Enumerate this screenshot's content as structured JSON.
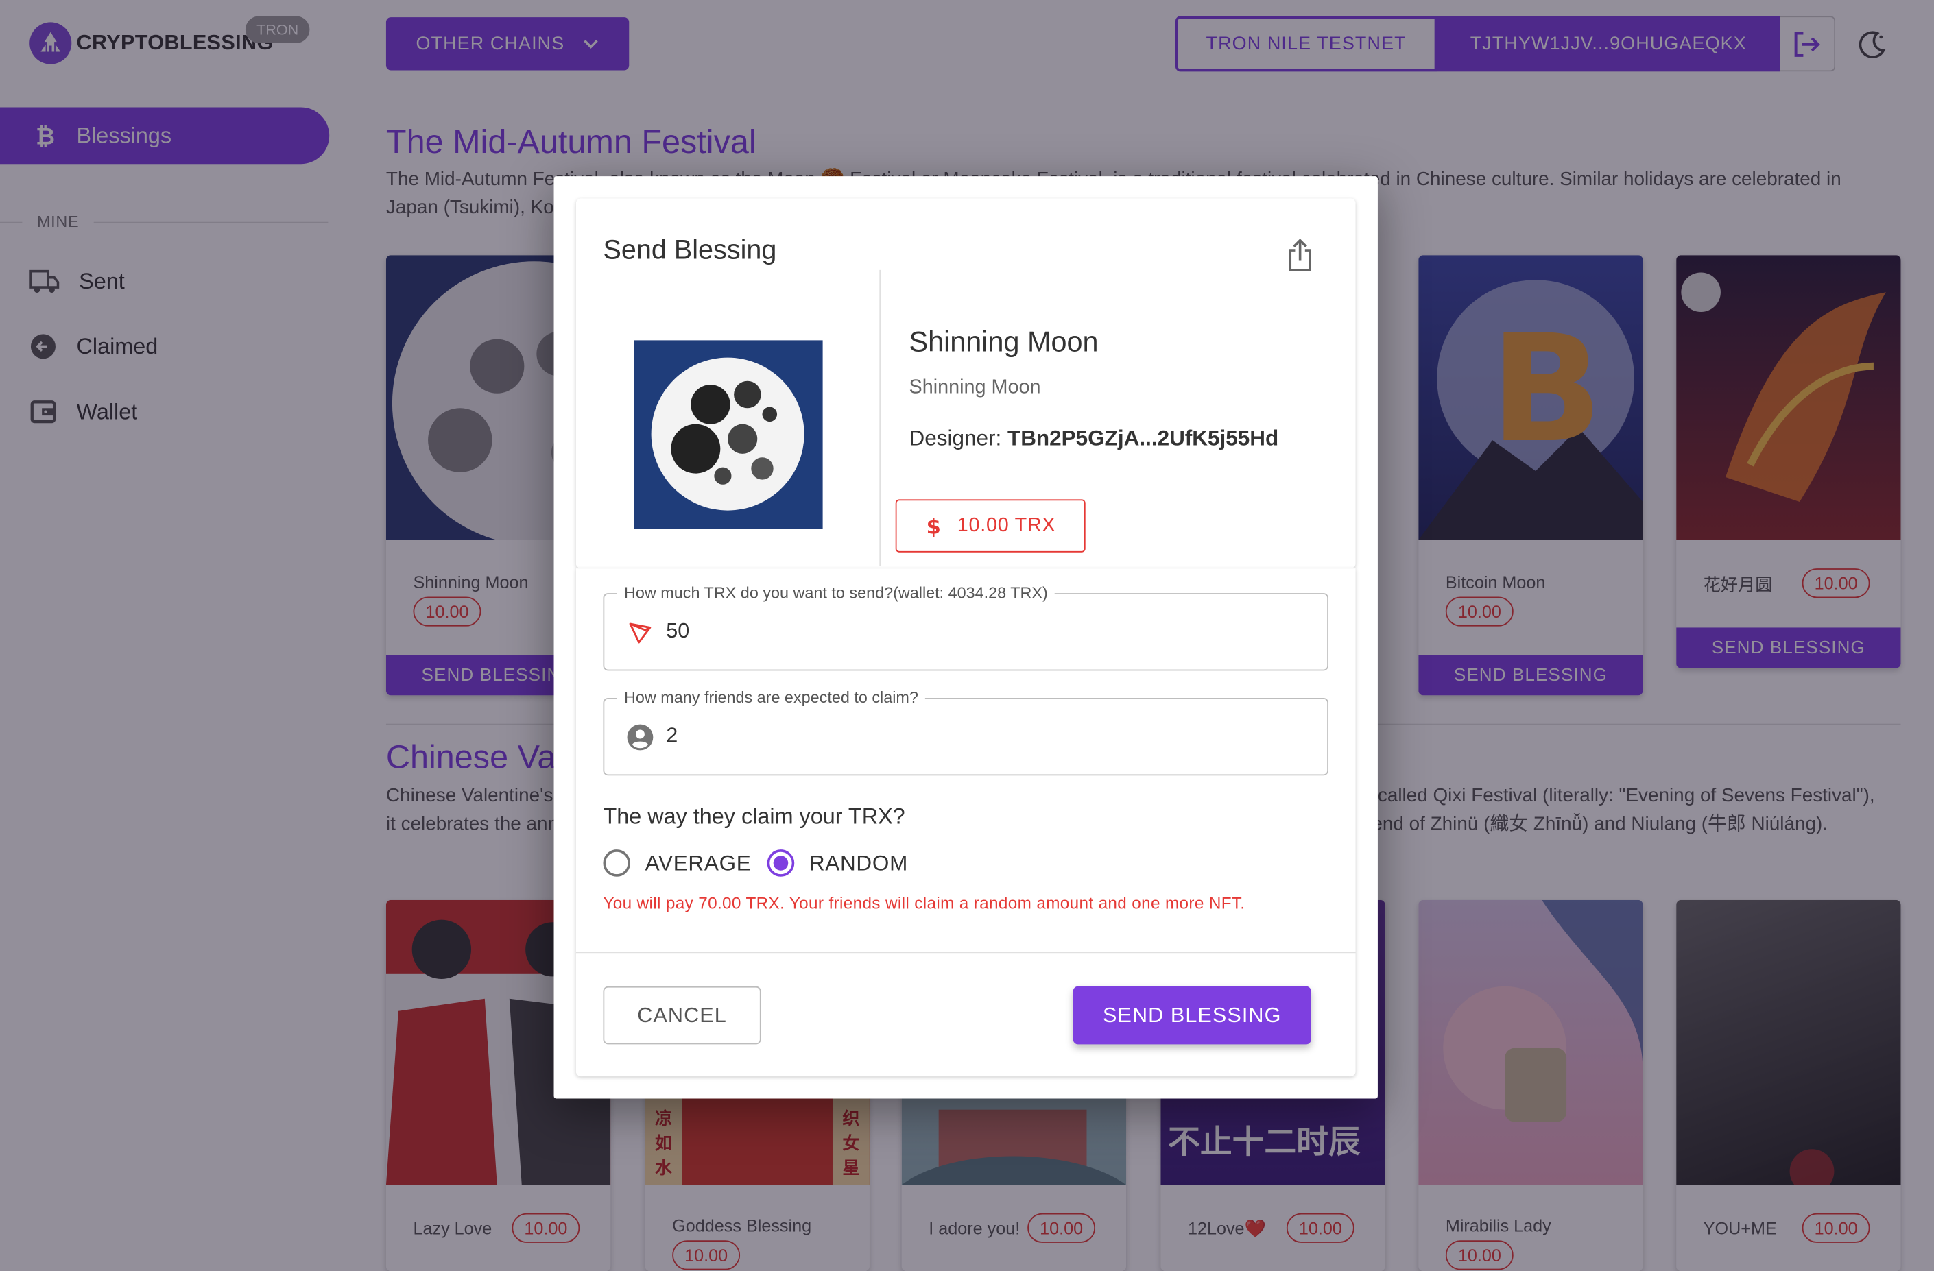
{
  "header": {
    "brand": "CRYPTOBLESSING",
    "chain_badge": "TRON",
    "chains_button": "OTHER CHAINS",
    "network_button": "TRON NILE TESTNET",
    "address_button": "TJTHYW1JJV...9OHUGAEQKX",
    "icons": {
      "logout": "logout-icon",
      "theme": "moon-icon",
      "dropdown": "chevron-down-icon"
    }
  },
  "sidebar": {
    "active": {
      "label": "Blessings",
      "icon": "bitcoin-icon"
    },
    "section_label": "MINE",
    "items": [
      {
        "label": "Sent",
        "icon": "sent-truck-icon"
      },
      {
        "label": "Claimed",
        "icon": "claimed-arrow-icon"
      },
      {
        "label": "Wallet",
        "icon": "wallet-icon"
      }
    ]
  },
  "sections": [
    {
      "title": "The Mid-Autumn Festival",
      "description": "The Mid-Autumn Festival, also known as the Moon 🥮 Festival or Mooncake Festival, is a traditional festival celebrated in Chinese culture. Similar holidays are celebrated in Japan (Tsukimi), Korea (Chuseok), Vietnam (Tết Trung Thu), and other countries in East and Southeast Asia.",
      "cards": [
        {
          "name": "Shinning Moon",
          "price": "10.00",
          "button": "SEND BLESSING"
        },
        {
          "name": "Bitcoin Moon",
          "price": "10.00",
          "button": "SEND BLESSING"
        },
        {
          "name": "花好月圆",
          "price": "10.00",
          "button": "SEND BLESSING"
        }
      ]
    },
    {
      "title": "Chinese Valentine's Day",
      "description": "Chinese Valentine's Day is a Chinese festival that falls on the 7th day of the 7th month on the Chinese calendar. Also called Qixi Festival (literally: \"Evening of Sevens Festival\"), it celebrates the annual meeting of the cowherd and weaver girl in Chinese mythology. It stems from the romantic legend of Zhinü (織女 Zhīnǚ) and Niulang (牛郎 Niúláng).",
      "cards": [
        {
          "name": "Lazy Love",
          "price": "10.00"
        },
        {
          "name": "Goddess Blessing",
          "price": "10.00"
        },
        {
          "name": "I adore you!",
          "price": "10.00"
        },
        {
          "name": "12Love❤️",
          "price": "10.00"
        },
        {
          "name": "Mirabilis Lady",
          "price": "10.00"
        },
        {
          "name": "YOU+ME",
          "price": "10.00"
        }
      ],
      "art_text": {
        "poster_a": "凉如水",
        "poster_b": "织女星",
        "banner": "不止十二时辰"
      }
    }
  ],
  "dialog": {
    "title": "Send Blessing",
    "share_icon": "share-icon",
    "nft": {
      "name": "Shinning Moon",
      "subtitle": "Shinning Moon",
      "designer_label": "Designer:",
      "designer_address": "TBn2P5GZjA...2UfK5j55Hd",
      "price": "10.00 TRX",
      "price_icon": "dollar-icon"
    },
    "amount_field": {
      "label": "How much TRX do you want to send?(wallet: 4034.28 TRX)",
      "value": "50",
      "icon": "tron-icon"
    },
    "friends_field": {
      "label": "How many friends are expected to claim?",
      "value": "2",
      "icon": "account-icon"
    },
    "claim_question": "The way they claim your TRX?",
    "claim_options": [
      {
        "label": "AVERAGE",
        "selected": false
      },
      {
        "label": "RANDOM",
        "selected": true
      }
    ],
    "pay_note": "You will pay 70.00 TRX. Your friends will claim a random amount and one more NFT.",
    "cancel_button": "CANCEL",
    "send_button": "SEND BLESSING"
  },
  "colors": {
    "accent": "#7e3fe0",
    "danger": "#e53935",
    "overlay": "rgba(25,18,40,0.47)"
  }
}
